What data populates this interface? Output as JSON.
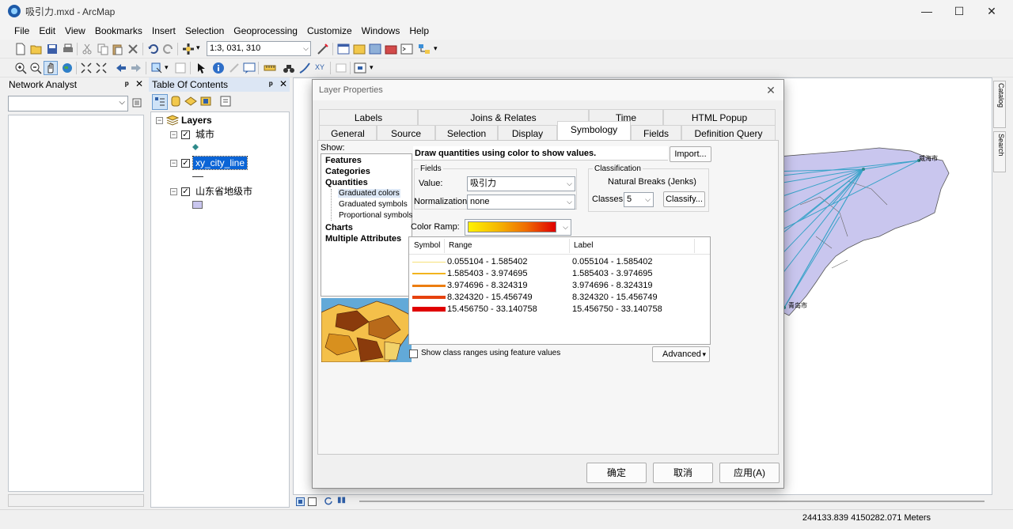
{
  "window": {
    "title": "吸引力.mxd - ArcMap",
    "minimize": "—",
    "maximize": "☐",
    "close": "✕"
  },
  "menu": [
    "File",
    "Edit",
    "View",
    "Bookmarks",
    "Insert",
    "Selection",
    "Geoprocessing",
    "Customize",
    "Windows",
    "Help"
  ],
  "toolbar": {
    "scale": "1:3, 031, 310"
  },
  "network_analyst": {
    "title": "Network Analyst",
    "pin": "ᵖ",
    "close": "✕"
  },
  "toc": {
    "title": "Table Of Contents",
    "pin": "ᵖ",
    "close": "✕",
    "root": "Layers",
    "layers": [
      {
        "name": "城市",
        "checked": true
      },
      {
        "name": "xy_city_line",
        "checked": true,
        "selected": true
      },
      {
        "name": "山东省地级市",
        "checked": true
      }
    ]
  },
  "map": {
    "labels": [
      "威海市",
      "青岛市"
    ],
    "colors": {
      "polygon": "#c9c6ee",
      "lines": "#3aa3c9"
    }
  },
  "right_bar": {
    "catalog": "Catalog",
    "search": "Search"
  },
  "status": {
    "coords": "244133.839  4150282.071 Meters"
  },
  "dialog": {
    "title": "Layer Properties",
    "close": "✕",
    "tabs_row1": [
      "Labels",
      "Joins & Relates",
      "Time",
      "HTML Popup"
    ],
    "tabs_row2": [
      "General",
      "Source",
      "Selection",
      "Display",
      "Symbology",
      "Fields",
      "Definition Query"
    ],
    "active_tab": "Symbology",
    "show_label": "Show:",
    "show_items": [
      {
        "label": "Features",
        "bold": true
      },
      {
        "label": "Categories",
        "bold": true
      },
      {
        "label": "Quantities",
        "bold": true
      },
      {
        "label": "Graduated colors",
        "bold": false,
        "selected": true
      },
      {
        "label": "Graduated symbols",
        "bold": false
      },
      {
        "label": "Proportional symbols",
        "bold": false
      },
      {
        "label": "Charts",
        "bold": true
      },
      {
        "label": "Multiple Attributes",
        "bold": true
      }
    ],
    "description": "Draw quantities using color to show values.",
    "import_btn": "Import...",
    "fields_label": "Fields",
    "value_label": "Value:",
    "value": "吸引力",
    "normalization_label": "Normalization:",
    "normalization": "none",
    "classification_label": "Classification",
    "method": "Natural Breaks (Jenks)",
    "classes_label": "Classes:",
    "classes": "5",
    "classify_btn": "Classify...",
    "color_ramp_label": "Color Ramp:",
    "table_headers": {
      "symbol": "Symbol",
      "range": "Range",
      "label": "Label"
    },
    "classes_list": [
      {
        "range": "0.055104 - 1.585402",
        "label": "0.055104 - 1.585402",
        "color": "#f7e27a",
        "width": 1
      },
      {
        "range": "1.585403 - 3.974695",
        "label": "1.585403 - 3.974695",
        "color": "#f2b41e",
        "width": 2
      },
      {
        "range": "3.974696 - 8.324319",
        "label": "3.974696 - 8.324319",
        "color": "#ec7d10",
        "width": 3
      },
      {
        "range": "8.324320 - 15.456749",
        "label": "8.324320 - 15.456749",
        "color": "#e6420e",
        "width": 4
      },
      {
        "range": "15.456750 - 33.140758",
        "label": "15.456750 - 33.140758",
        "color": "#e00000",
        "width": 6
      }
    ],
    "show_ranges_label": "Show class ranges using feature values",
    "advanced_btn": "Advanced",
    "ok": "确定",
    "cancel": "取消",
    "apply": "应用(A)"
  }
}
